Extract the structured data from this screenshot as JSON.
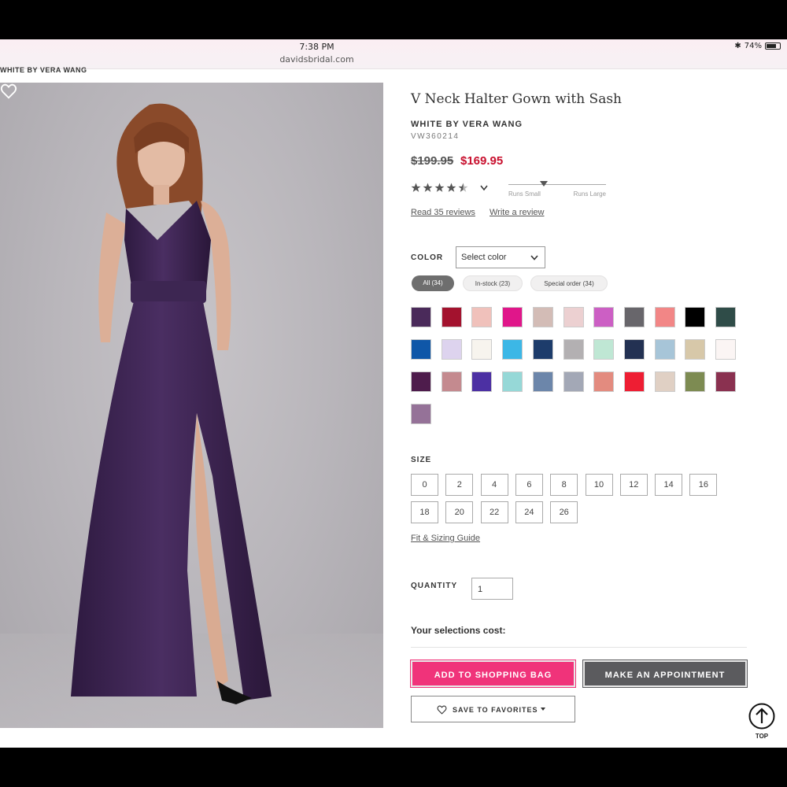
{
  "status_bar": {
    "time": "7:38 PM",
    "url": "davidsbridal.com",
    "battery": "74%",
    "battery_level": 0.74,
    "bluetooth_icon": "bluetooth-icon"
  },
  "breadcrumb": {
    "brand": "WHITE BY VERA WANG"
  },
  "product": {
    "title": "V Neck Halter Gown with Sash",
    "brand": "WHITE BY VERA WANG",
    "sku": "VW360214",
    "price_original": "$199.95",
    "price_sale": "$169.95",
    "rating": 4.5,
    "rating_max": 5,
    "fit": {
      "runs_small": "Runs Small",
      "runs_large": "Runs Large"
    },
    "read_reviews": "Read 35 reviews",
    "write_review": "Write a review"
  },
  "color": {
    "label": "COLOR",
    "select_placeholder": "Select color",
    "filters": [
      {
        "label": "All (34)",
        "active": true
      },
      {
        "label": "In-stock (23)",
        "active": false
      },
      {
        "label": "Special order (34)",
        "active": false
      }
    ],
    "swatches": [
      "#4a2a5a",
      "#a3122e",
      "#f0c1bb",
      "#e0168a",
      "#d3bcb6",
      "#ecd0d1",
      "#cc5fc4",
      "#68666b",
      "#f28686",
      "#000000",
      "#2f4c48",
      "#0f57a8",
      "#ddd3ee",
      "#f7f4ee",
      "#3cb7e6",
      "#1d3c6b",
      "#b3b0b2",
      "#bfe7d4",
      "#233152",
      "#a7c5d8",
      "#d7c8a9",
      "#fbf5f4",
      "#4e1c4c",
      "#c48a8f",
      "#4c30a3",
      "#96d8d7",
      "#6c86aa",
      "#a3a8b6",
      "#e38b7f",
      "#ee1e33",
      "#e0d0c4",
      "#7d8b52",
      "#8a3150",
      "#957298"
    ]
  },
  "size": {
    "label": "SIZE",
    "options": [
      "0",
      "2",
      "4",
      "6",
      "8",
      "10",
      "12",
      "14",
      "16",
      "18",
      "20",
      "22",
      "24",
      "26"
    ],
    "guide": "Fit & Sizing Guide"
  },
  "quantity": {
    "label": "QUANTITY",
    "value": "1"
  },
  "cost": {
    "label": "Your selections cost:"
  },
  "buttons": {
    "add_to_bag": "ADD TO SHOPPING BAG",
    "appointment": "MAKE AN APPOINTMENT",
    "save_favorites": "SAVE TO FAVORITES",
    "top": "TOP"
  },
  "colors": {
    "accent": "#f0337a",
    "sale": "#c8102e",
    "dark_button": "#5b5b5e",
    "dress": "#3b2450"
  }
}
